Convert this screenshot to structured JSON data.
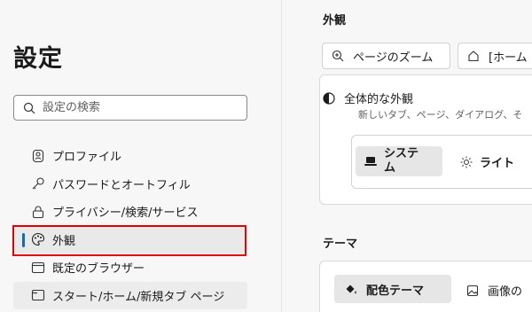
{
  "sidebar": {
    "title": "設定",
    "search_placeholder": "設定の検索",
    "items": [
      {
        "label": "プロファイル",
        "icon": "profile-icon"
      },
      {
        "label": "パスワードとオートフィル",
        "icon": "key-icon"
      },
      {
        "label": "プライバシー/検索/サービス",
        "icon": "lock-icon"
      },
      {
        "label": "外観",
        "icon": "palette-icon",
        "active": true
      },
      {
        "label": "既定のブラウザー",
        "icon": "browser-icon"
      },
      {
        "label": "スタート/ホーム/新規タブ ページ",
        "icon": "newtab-icon"
      }
    ]
  },
  "main": {
    "appearance_heading": "外観",
    "chips": [
      {
        "label": "ページのズーム",
        "icon": "zoom-in-icon"
      },
      {
        "label": "[ホーム",
        "icon": "home-icon"
      }
    ],
    "overall": {
      "title": "全体的な外観",
      "description": "新しいタブ、ページ、ダイアログ、そ",
      "options": [
        {
          "label": "システム",
          "icon": "laptop-icon",
          "selected": true
        },
        {
          "label": "ライト",
          "icon": "sun-icon"
        }
      ]
    },
    "theme_heading": "テーマ",
    "theme_tabs": [
      {
        "label": "配色テーマ",
        "icon": "paint-bucket-icon",
        "selected": true
      },
      {
        "label": "画像の",
        "icon": "image-icon"
      }
    ]
  },
  "colors": {
    "accent": "#0f6cbd",
    "highlight": "#e00000"
  }
}
